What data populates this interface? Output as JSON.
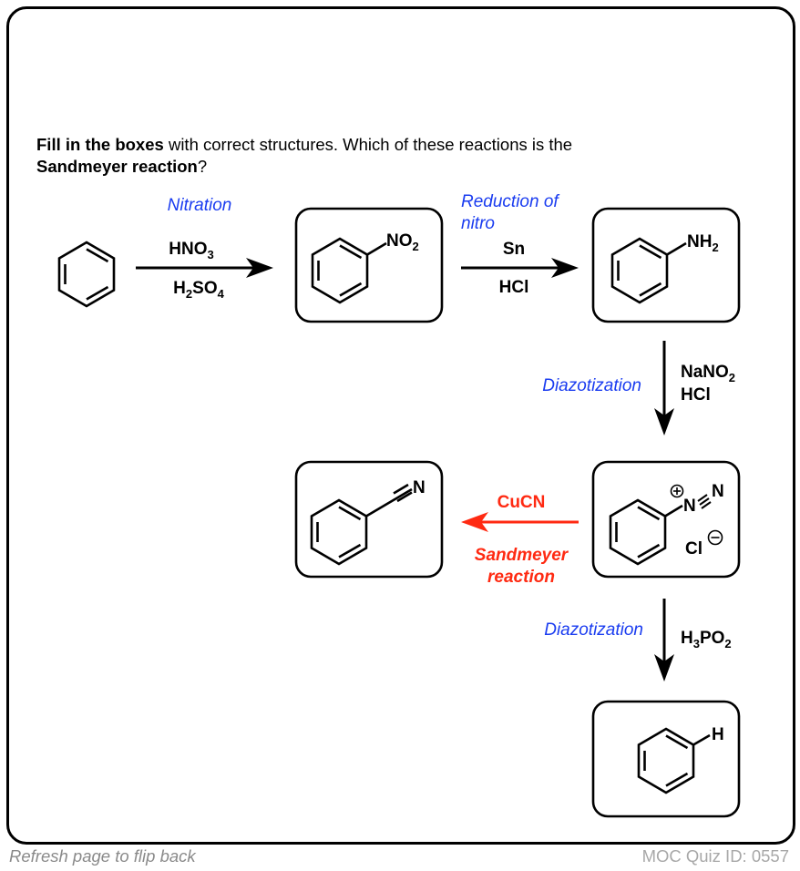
{
  "prompt": {
    "bold_lead": "Fill in the boxes",
    "text_mid": " with correct structures. Which of these reactions is the ",
    "bold_tail": "Sandmeyer reaction",
    "text_end": "?"
  },
  "colors": {
    "label_blue": "#1a3cf0",
    "sandmeyer_red": "#ff2a12",
    "ink": "#000000",
    "footer_gray": "#8a8a8a"
  },
  "steps": [
    {
      "name": "Nitration",
      "reagent_top": "HNO",
      "reagent_top_sub": "3",
      "reagent_bottom": "H",
      "reagent_bottom_sub": "2",
      "reagent_bottom_rest": "SO",
      "reagent_bottom_sub2": "4"
    },
    {
      "name_line1": "Reduction of",
      "name_line2": "nitro",
      "reagent_top": "Sn",
      "reagent_bottom": "HCl"
    },
    {
      "name": "Diazotization",
      "reagent_top": "NaNO",
      "reagent_top_sub": "2",
      "reagent_bottom": "HCl"
    },
    {
      "name": "CuCN",
      "label_line1": "Sandmeyer",
      "label_line2": "reaction"
    },
    {
      "name": "Diazotization",
      "reagent": "H",
      "reagent_sub1": "3",
      "reagent_mid": "PO",
      "reagent_sub2": "2"
    }
  ],
  "structures": {
    "nitrobenzene": {
      "group": "NO",
      "group_sub": "2"
    },
    "aniline": {
      "group": "NH",
      "group_sub": "2"
    },
    "diazonium": {
      "n1": "N",
      "n2": "N",
      "plus": "+",
      "counterion": "Cl",
      "minus": "−"
    },
    "benzonitrile": {
      "group": "N"
    },
    "benzene_h": {
      "group": "H"
    }
  },
  "footer": {
    "left": "Refresh page to flip back",
    "right": "MOC Quiz ID: 0557"
  }
}
